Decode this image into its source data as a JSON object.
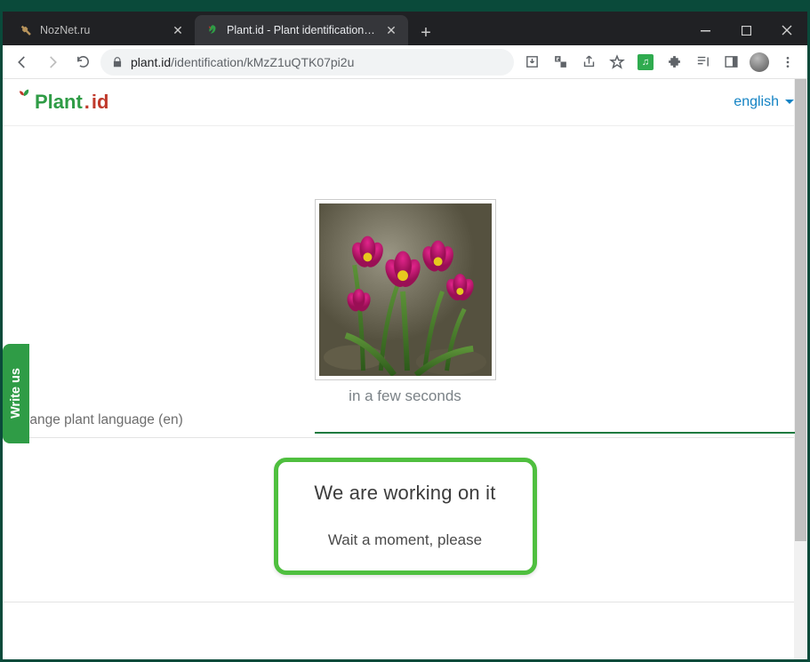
{
  "window": {
    "tabs": [
      {
        "title": "NozNet.ru",
        "active": false
      },
      {
        "title": "Plant.id - Plant identification app",
        "active": true
      }
    ]
  },
  "browser": {
    "url_host": "plant.id",
    "url_path": "/identification/kMzZ1uQTK07pi2u"
  },
  "site": {
    "logo_text_a": "Plant",
    "logo_text_b": ".",
    "logo_text_c": "id",
    "language_label": "english"
  },
  "main": {
    "eta_text": "in a few seconds",
    "change_lang_text": "change plant language (en)",
    "callout_heading": "We are working on it",
    "callout_sub": "Wait a moment, please"
  },
  "feedback": {
    "label": "Write us"
  }
}
